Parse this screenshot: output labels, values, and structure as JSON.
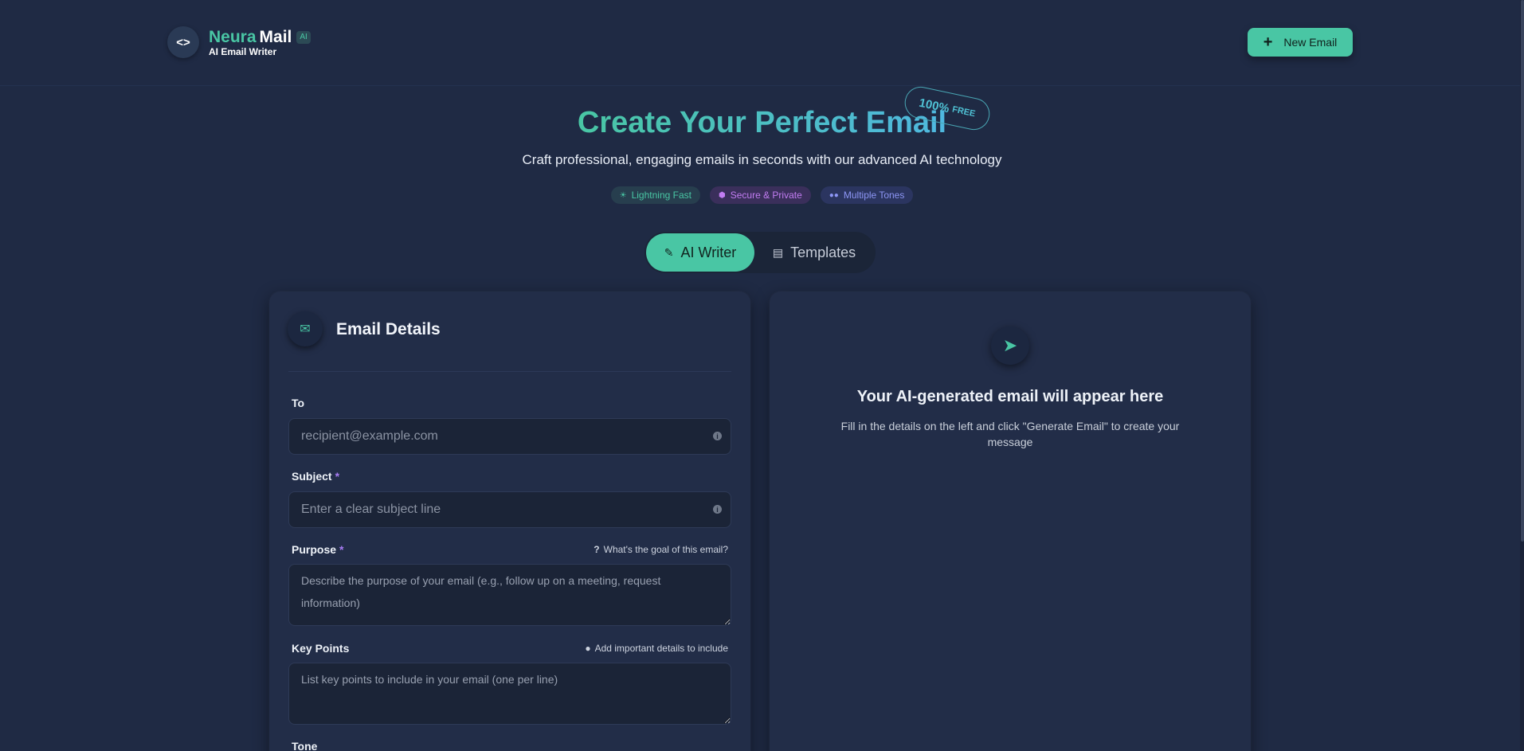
{
  "header": {
    "brand_name_1": "Neura",
    "brand_name_2": "Mail",
    "brand_badge": "AI",
    "brand_sub": "AI Email Writer",
    "new_email_label": "New Email"
  },
  "hero": {
    "title": "Create Your Perfect Email",
    "badge_number": "100%",
    "badge_text": "FREE",
    "subtitle": "Craft professional, engaging emails in seconds with our advanced AI technology",
    "chips": [
      {
        "label": "Lightning Fast",
        "icon": "bolt-icon"
      },
      {
        "label": "Secure & Private",
        "icon": "shield-icon"
      },
      {
        "label": "Multiple Tones",
        "icon": "users-icon"
      }
    ]
  },
  "tabs": [
    {
      "label": "AI Writer",
      "icon": "magic-wand-icon",
      "active": true
    },
    {
      "label": "Templates",
      "icon": "file-icon",
      "active": false
    }
  ],
  "form": {
    "title": "Email Details",
    "to": {
      "label": "To",
      "placeholder": "recipient@example.com"
    },
    "subject": {
      "label": "Subject",
      "required": "*",
      "placeholder": "Enter a clear subject line"
    },
    "purpose": {
      "label": "Purpose",
      "required": "*",
      "hint": "What's the goal of this email?",
      "placeholder": "Describe the purpose of your email (e.g., follow up on a meeting, request information)"
    },
    "key_points": {
      "label": "Key Points",
      "hint": "Add important details to include",
      "placeholder": "List key points to include in your email (one per line)"
    },
    "tone": {
      "label": "Tone"
    }
  },
  "preview": {
    "title": "Your AI-generated email will appear here",
    "subtitle": "Fill in the details on the left and click \"Generate Email\" to create your message"
  },
  "colors": {
    "background": "#1f2a44",
    "accent": "#49c6a4",
    "purple": "#c27df2",
    "indigo": "#8d96f5"
  }
}
